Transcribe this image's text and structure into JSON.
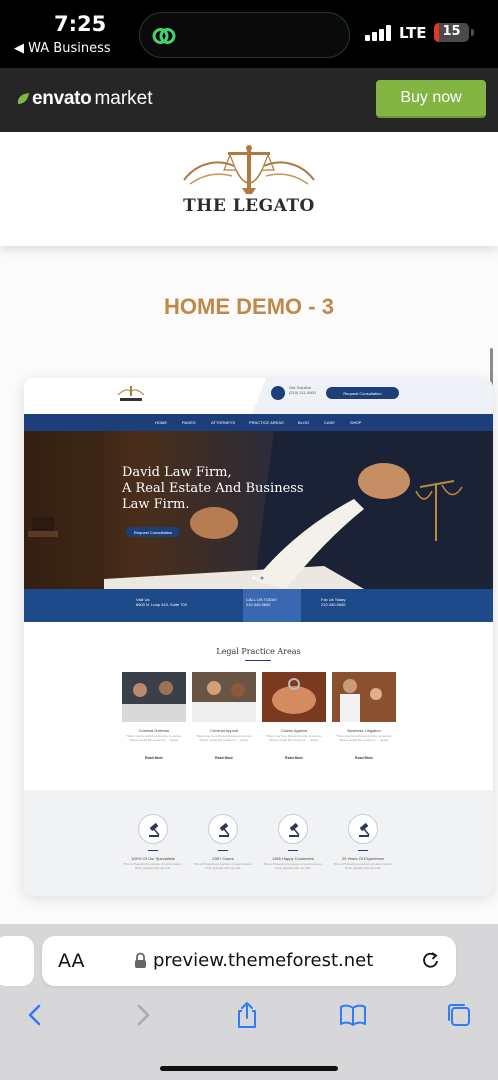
{
  "status_bar": {
    "time": "7:25",
    "back_app": "◀ WA Business",
    "network": "LTE",
    "battery_percent": 15,
    "battery_label": "15"
  },
  "envato": {
    "brand_name": "envato",
    "brand_suffix": "market",
    "buy_label": "Buy now",
    "accent_color": "#82b541"
  },
  "site_logo": {
    "name": "THE LEGATO"
  },
  "demo": {
    "title": "HOME DEMO - 3",
    "title_color": "#c0894a"
  },
  "preview": {
    "phone_label": "Get Solution",
    "phone_number": "(210) 111-0000",
    "consult_label": "Request Consultation",
    "nav": [
      "HOME",
      "PAGES",
      "ATTORNEYS",
      "PRACTICE AREAS",
      "BLOG",
      "CASE",
      "SHOP"
    ],
    "hero_line1": "David Law Firm,",
    "hero_line2": "A Real Estate And Business",
    "hero_line3": "Law Firm.",
    "hero_button": "Request Consultation",
    "info_left_title": "Visit Us",
    "info_left_text": "6600 N. Loop 410, Suite 700",
    "info_mid_title": "CALL US TODAY",
    "info_mid_text": "210.340.0630",
    "info_right_title": "Fax Us Today",
    "info_right_text": "210.340.0630",
    "section_title": "Legal Practice Areas",
    "practice_cards": [
      {
        "title": "Criminal Defense",
        "desc": "There may be a Roman Empire to source. Where would the content is ... nearly.",
        "more": "Read More"
      },
      {
        "title": "Criminal Appeal",
        "desc": "There may be a Roman Empire to source. Where would the content is ... nearly.",
        "more": "Read More"
      },
      {
        "title": "Claims Against",
        "desc": "There may be a Roman Empire to source. Where would the content is ... nearly.",
        "more": "Read More"
      },
      {
        "title": "Business Litigation",
        "desc": "There may be a Roman Empire to source. Where would the content is ... nearly.",
        "more": "Read More"
      }
    ],
    "stats": [
      {
        "title": "100% Of Our Specialists",
        "desc": "This is Photoshop's version of Lorem Ipsum. Proin gravida nibh vel velit."
      },
      {
        "title": "235+ Cases",
        "desc": "This is Photoshop's version of Lorem Ipsum. Proin gravida nibh vel velit."
      },
      {
        "title": "1365 Happy Costumers",
        "desc": "This is Photoshop's version of Lorem Ipsum. Proin gravida nibh vel velit."
      },
      {
        "title": "25 Years Of Experience",
        "desc": "This is Photoshop's version of Lorem Ipsum. Proin gravida nibh vel velit."
      }
    ]
  },
  "browser": {
    "aa_label": "AA",
    "url": "preview.themeforest.net",
    "toolbar_icons": [
      "back-icon",
      "forward-icon",
      "share-icon",
      "bookmarks-icon",
      "tabs-icon"
    ]
  }
}
